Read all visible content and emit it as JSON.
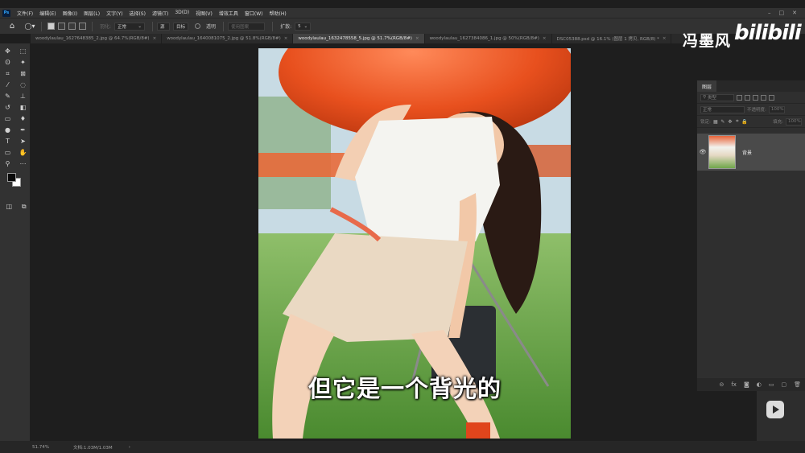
{
  "app": {
    "logo": "Ps"
  },
  "menu": [
    "文件(F)",
    "编辑(E)",
    "图像(I)",
    "图层(L)",
    "文字(Y)",
    "选择(S)",
    "滤镜(T)",
    "3D(D)",
    "视图(V)",
    "增效工具",
    "窗口(W)",
    "帮助(H)"
  ],
  "window_controls": [
    "–",
    "□",
    "✕"
  ],
  "options": {
    "feather_label": "羽化:",
    "blend_value": "正常",
    "sample_label": "源",
    "target_label": "目标",
    "transparent_label": "透明",
    "use_pattern_label": "使用图案",
    "spread_label": "扩散:",
    "spread_value": "5"
  },
  "tabs": [
    {
      "label": "woodylaulau_1627648385_2.jpg @ 64.7%(RGB/8#)",
      "close": "×",
      "active": false
    },
    {
      "label": "woodylaulau_1640081075_2.jpg @ 51.8%(RGB/8#)",
      "close": "×",
      "active": false
    },
    {
      "label": "woodylaulau_1632478558_5.jpg @ 51.7%(RGB/8#)",
      "close": "×",
      "active": true
    },
    {
      "label": "woodylaulau_1627384086_1.jpg @ 50%(RGB/8#)",
      "close": "×",
      "active": false
    },
    {
      "label": "DSC05388.psd @ 16.1% (图层 1 拷贝, RGB/8) *",
      "close": "×",
      "active": false
    }
  ],
  "tools": [
    {
      "icon": "move-icon",
      "glyph": "✥"
    },
    {
      "icon": "marquee-icon",
      "glyph": "⬚"
    },
    {
      "icon": "lasso-icon",
      "glyph": "ʘ"
    },
    {
      "icon": "magic-wand-icon",
      "glyph": "✦"
    },
    {
      "icon": "crop-icon",
      "glyph": "⌗"
    },
    {
      "icon": "frame-icon",
      "glyph": "⊠"
    },
    {
      "icon": "eyedropper-icon",
      "glyph": "⁄"
    },
    {
      "icon": "spot-heal-icon",
      "glyph": "◌"
    },
    {
      "icon": "brush-icon",
      "glyph": "✎"
    },
    {
      "icon": "stamp-icon",
      "glyph": "⊥"
    },
    {
      "icon": "history-brush-icon",
      "glyph": "↺"
    },
    {
      "icon": "eraser-icon",
      "glyph": "◧"
    },
    {
      "icon": "gradient-icon",
      "glyph": "▭"
    },
    {
      "icon": "blur-icon",
      "glyph": "♦"
    },
    {
      "icon": "dodge-icon",
      "glyph": "●"
    },
    {
      "icon": "pen-icon",
      "glyph": "✒"
    },
    {
      "icon": "type-icon",
      "glyph": "T"
    },
    {
      "icon": "path-select-icon",
      "glyph": "➤"
    },
    {
      "icon": "rectangle-icon",
      "glyph": "▭"
    },
    {
      "icon": "hand-icon",
      "glyph": "✋"
    },
    {
      "icon": "zoom-icon",
      "glyph": "⚲"
    },
    {
      "icon": "more-tools-icon",
      "glyph": "⋯"
    }
  ],
  "subtitle": "但它是一个背光的",
  "status": {
    "zoom": "51.74%",
    "doc": "文档:1.03M/1.03M",
    "arrow": "›"
  },
  "layers_panel": {
    "tab": "图层",
    "filter_placeholder": "类型",
    "blend_mode": "正常",
    "opacity_label": "不透明度:",
    "opacity_value": "100%",
    "lock_label": "锁定:",
    "fill_label": "填充:",
    "fill_value": "100%",
    "layer_name": "背景",
    "footer_icons": [
      "link-icon",
      "fx-icon",
      "mask-icon",
      "adjustment-icon",
      "group-icon",
      "new-layer-icon",
      "trash-icon"
    ],
    "footer_glyphs": [
      "⊝",
      "fx",
      "◙",
      "◐",
      "▭",
      "▢",
      "🗑"
    ]
  },
  "watermark": {
    "author": "冯墨风",
    "site": "bilibili"
  },
  "colors": {
    "fg": "#0a0a0a",
    "bg": "#ffffff",
    "accent": "#31a8ff",
    "balloon": "#e8501e"
  }
}
